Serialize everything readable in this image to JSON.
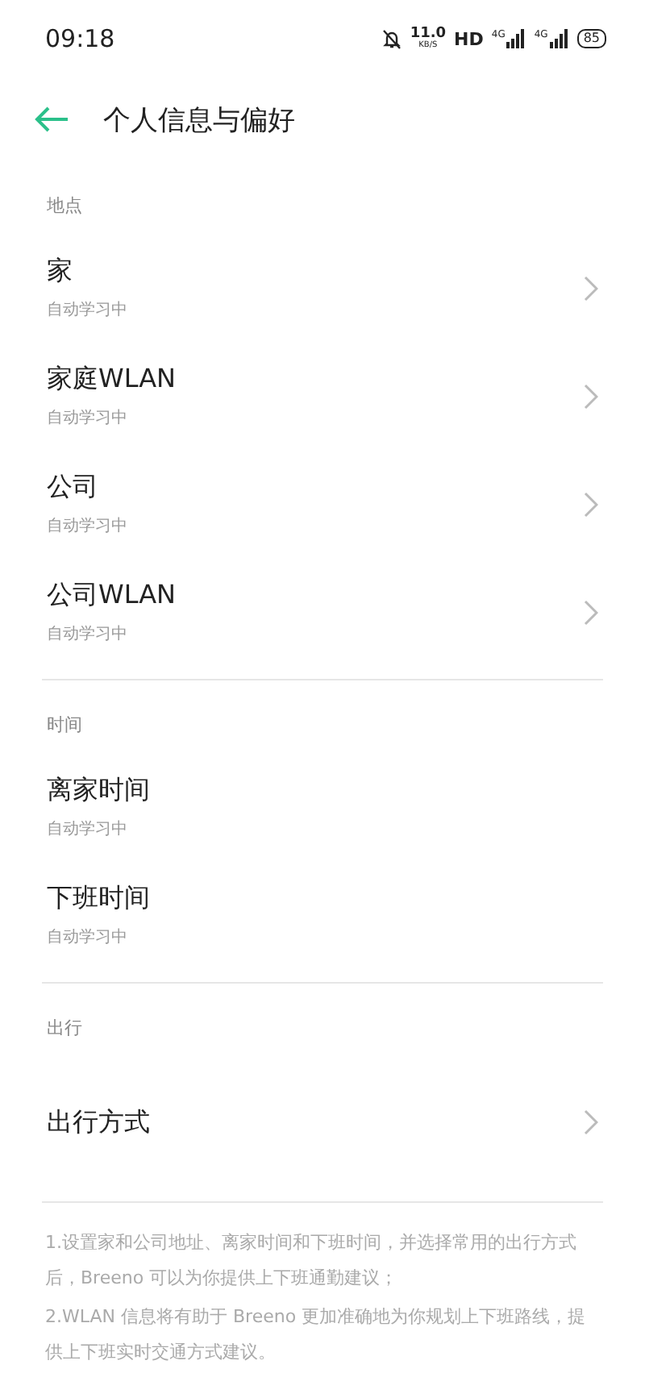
{
  "status_bar": {
    "time": "09:18",
    "speed": "11.0",
    "speed_unit": "KB/S",
    "hd": "HD",
    "networks": [
      "4G",
      "4G"
    ],
    "battery": "85"
  },
  "header": {
    "title": "个人信息与偏好"
  },
  "sections": [
    {
      "title": "地点",
      "items": [
        {
          "kind": "link",
          "title": "家",
          "subtitle": "自动学习中"
        },
        {
          "kind": "link",
          "title": "家庭WLAN",
          "subtitle": "自动学习中"
        },
        {
          "kind": "link",
          "title": "公司",
          "subtitle": "自动学习中"
        },
        {
          "kind": "link",
          "title": "公司WLAN",
          "subtitle": "自动学习中"
        }
      ]
    },
    {
      "title": "时间",
      "items": [
        {
          "kind": "plain",
          "title": "离家时间",
          "subtitle": "自动学习中"
        },
        {
          "kind": "plain",
          "title": "下班时间",
          "subtitle": "自动学习中"
        }
      ]
    },
    {
      "title": "出行",
      "items": [
        {
          "kind": "link",
          "title": "出行方式"
        }
      ]
    }
  ],
  "notes": [
    "1.设置家和公司地址、离家时间和下班时间，并选择常用的出行方式后，Breeno 可以为你提供上下班通勤建议；",
    "2.WLAN 信息将有助于 Breeno 更加准确地为你规划上下班路线，提供上下班实时交通方式建议。"
  ]
}
